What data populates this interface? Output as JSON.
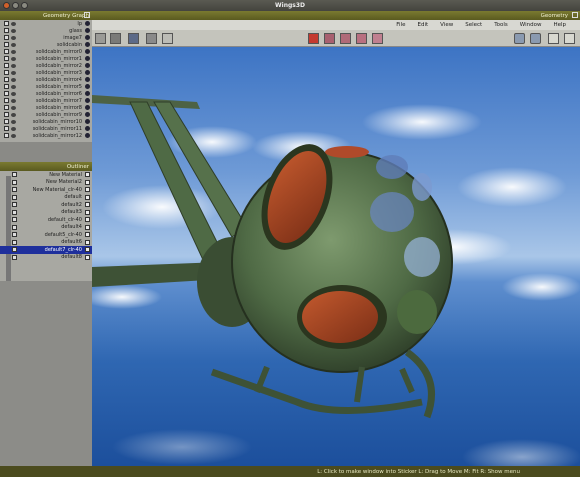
{
  "app": {
    "title": "Wings3D"
  },
  "outliner": {
    "title": "Geometry Graph",
    "items": [
      {
        "name": "Ip"
      },
      {
        "name": "glass"
      },
      {
        "name": "image7"
      },
      {
        "name": "solidcabin"
      },
      {
        "name": "solidcabin_mirror0"
      },
      {
        "name": "solidcabin_mirror1"
      },
      {
        "name": "solidcabin_mirror2"
      },
      {
        "name": "solidcabin_mirror3"
      },
      {
        "name": "solidcabin_mirror4"
      },
      {
        "name": "solidcabin_mirror5"
      },
      {
        "name": "solidcabin_mirror6"
      },
      {
        "name": "solidcabin_mirror7"
      },
      {
        "name": "solidcabin_mirror8"
      },
      {
        "name": "solidcabin_mirror9"
      },
      {
        "name": "solidcabin_mirror10"
      },
      {
        "name": "solidcabin_mirror11"
      },
      {
        "name": "solidcabin_mirror12"
      }
    ]
  },
  "materials": {
    "title": "Outliner",
    "items": [
      {
        "name": "New Material",
        "selected": false
      },
      {
        "name": "New Material2",
        "selected": false
      },
      {
        "name": "New Material_clr-40",
        "selected": false
      },
      {
        "name": "default",
        "selected": false
      },
      {
        "name": "default2",
        "selected": false
      },
      {
        "name": "default3",
        "selected": false
      },
      {
        "name": "default_clr-40",
        "selected": false
      },
      {
        "name": "default4",
        "selected": false
      },
      {
        "name": "default5_clr-40",
        "selected": false
      },
      {
        "name": "default6",
        "selected": false
      },
      {
        "name": "default7_clr-40",
        "selected": true
      },
      {
        "name": "default8",
        "selected": false
      }
    ]
  },
  "main": {
    "title": "Geometry",
    "menu": [
      "File",
      "Edit",
      "View",
      "Select",
      "Tools",
      "Window",
      "Help"
    ]
  },
  "statusbar": {
    "text": "L: Click to make window into Sticker   L: Drag to Move   M: Fit   R: Show menu"
  },
  "colors": {
    "title_bar": "#4a4a44",
    "panel_header": "#6b6b28",
    "selection": "#1e2f9c",
    "sky": "#5f8fcf",
    "helicopter": "#4f6a45"
  }
}
